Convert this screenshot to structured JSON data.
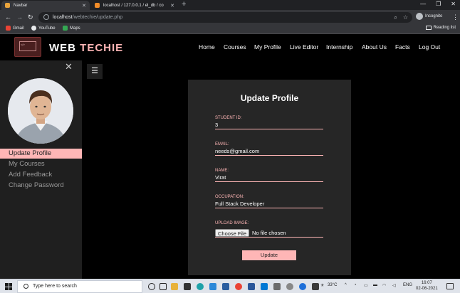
{
  "browser": {
    "tabs": [
      {
        "title": "Navbar",
        "active": true
      },
      {
        "title": "localhost / 127.0.0.1 / el_db / co",
        "active": false
      }
    ],
    "url_host": "localhost",
    "url_path": "/webtechie/update.php",
    "profile_label": "Incognito",
    "bookmarks": [
      "Gmail",
      "YouTube",
      "Maps"
    ],
    "reading_list": "Reading list"
  },
  "site": {
    "brand_part1": "WEB",
    "brand_part2": "TECHIE",
    "nav": [
      "Home",
      "Courses",
      "My Profile",
      "Live Editor",
      "Internship",
      "About Us",
      "Facts",
      "Log Out"
    ]
  },
  "sidebar": {
    "items": [
      "Update Profile",
      "My Courses",
      "Add Feedback",
      "Change Password"
    ],
    "active_index": 0
  },
  "form": {
    "title": "Update Profile",
    "fields": [
      {
        "label": "STUDENT ID:",
        "value": "3"
      },
      {
        "label": "EMAIL:",
        "value": "needs@gmail.com"
      },
      {
        "label": "NAME:",
        "value": "Virat"
      },
      {
        "label": "OCCUPATION:",
        "value": "Full Stack Developer"
      }
    ],
    "upload_label": "UPLOAD IMAGE:",
    "choose_file": "Choose File",
    "no_file": "No file chosen",
    "submit": "Update"
  },
  "taskbar": {
    "search_placeholder": "Type here to search",
    "temperature": "33°C",
    "language": "ENG",
    "time": "16:07",
    "date": "02-06-2021"
  },
  "colors": {
    "accent": "#ffb6b6",
    "card": "#262626",
    "sidebar": "#1f1f1f"
  }
}
